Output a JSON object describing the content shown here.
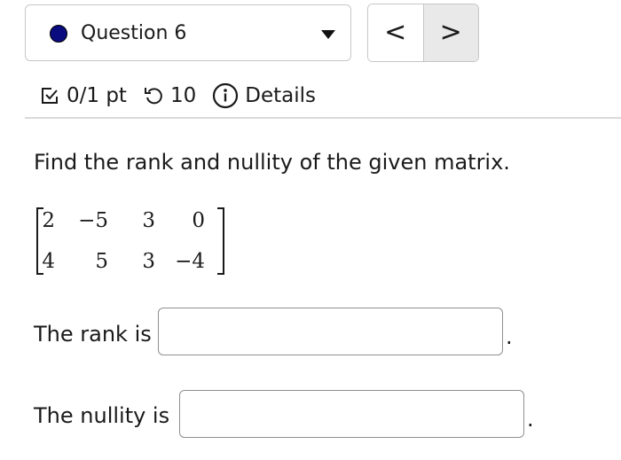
{
  "question_nav": {
    "label": "Question 6",
    "status_color": "#0b0b80",
    "prev_label": "<",
    "next_label": ">"
  },
  "meta": {
    "score": "0/1 pt",
    "attempts": "10",
    "details_label": "Details",
    "score_icon": "checkbox-icon",
    "attempts_icon": "retry-icon",
    "details_icon": "info-icon"
  },
  "problem": {
    "prompt": "Find the rank and nullity of the given matrix.",
    "matrix": [
      [
        "2",
        "−5",
        "3",
        "0"
      ],
      [
        "4",
        "5",
        "3",
        "−4"
      ]
    ]
  },
  "answers": [
    {
      "label": "The rank is",
      "value": "",
      "suffix": "."
    },
    {
      "label": "The nullity is",
      "value": "",
      "suffix": "."
    }
  ]
}
